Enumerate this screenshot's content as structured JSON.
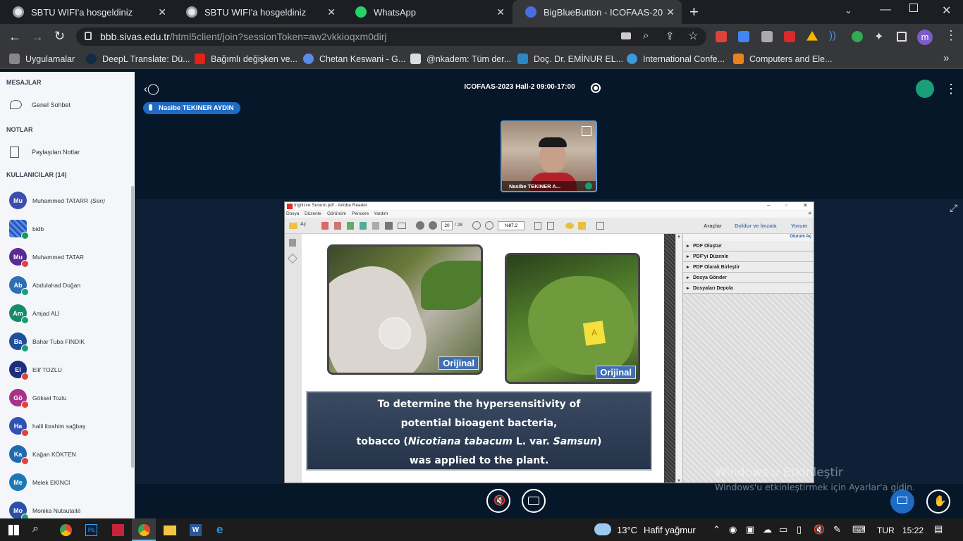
{
  "tabs": [
    {
      "title": "SBTU WIFI'a hosgeldiniz",
      "icon": "globe-icon"
    },
    {
      "title": "SBTU WIFI'a hosgeldiniz",
      "icon": "globe-icon"
    },
    {
      "title": "WhatsApp",
      "icon": "whatsapp-icon"
    },
    {
      "title": "BigBlueButton - ICOFAAS-2023 H",
      "icon": "bigbluebutton-icon"
    }
  ],
  "url": {
    "host": "bbb.sivas.edu.tr",
    "path": "/html5client/join?sessionToken=aw2vkkioqxm0dirj"
  },
  "bookmarks": [
    "Uygulamalar",
    "DeepL Translate: Dü...",
    "Bağımlı değişken ve...",
    "Chetan Keswani - G...",
    "@nkadem: Tüm der...",
    "Doç. Dr. EMİNUR EL...",
    "International Confe...",
    "Computers and Ele..."
  ],
  "profile_initial": "m",
  "sidebar": {
    "messages_header": "MESAJLAR",
    "public_chat": "Genel Sohbet",
    "notes_header": "NOTLAR",
    "shared_notes": "Paylaşılan Notlar",
    "users_header": "KULLANICILAR (14)",
    "users": [
      {
        "initials": "Mu",
        "name": "Muhammed TATARR",
        "suffix": "(Sen)",
        "color": "#3b4eab",
        "badge": ""
      },
      {
        "initials": "",
        "name": "bidb",
        "suffix": "",
        "color": "#2a57b8",
        "badge": "#0f9d58"
      },
      {
        "initials": "Mu",
        "name": "Muhammed TATAR",
        "suffix": "",
        "color": "#5b2a96",
        "badge": "#e0413b"
      },
      {
        "initials": "Ab",
        "name": "Abdulahad Doğan",
        "suffix": "",
        "color": "#2d6fb5",
        "badge": "#1a9e78"
      },
      {
        "initials": "Am",
        "name": "Amjad ALİ",
        "suffix": "",
        "color": "#168a6a",
        "badge": "#1a9e78"
      },
      {
        "initials": "Ba",
        "name": "Bahar Tuba FINDIK",
        "suffix": "",
        "color": "#1e4f9c",
        "badge": "#1a9e78"
      },
      {
        "initials": "El",
        "name": "Elif TOZLU",
        "suffix": "",
        "color": "#1b2f7a",
        "badge": "#e0413b"
      },
      {
        "initials": "Gö",
        "name": "Göksel Tozlu",
        "suffix": "",
        "color": "#a8328a",
        "badge": "#e0413b"
      },
      {
        "initials": "Ha",
        "name": "halil ibrahim sağbaş",
        "suffix": "",
        "color": "#3052b5",
        "badge": "#e0413b"
      },
      {
        "initials": "Ka",
        "name": "Kağan KÖKTEN",
        "suffix": "",
        "color": "#1f6ab0",
        "badge": "#e0413b"
      },
      {
        "initials": "Me",
        "name": "Melek EKİNCİ",
        "suffix": "",
        "color": "#1d78b8",
        "badge": ""
      },
      {
        "initials": "Mo",
        "name": "Monika Nutautaitė",
        "suffix": "",
        "color": "#2b4fa8",
        "badge": "#1a9e78"
      }
    ]
  },
  "meeting": {
    "title": "ICOFAAS-2023 Hall-2 09:00-17:00",
    "presenter": "Nasibe TEKINER AYDIN",
    "video_label": "Nasibe TEKINER A..."
  },
  "reader": {
    "title": "Ingilizce Sunum.pdf - Adobe Reader",
    "menu": [
      "Dosya",
      "Düzenle",
      "Görünüm",
      "Pencere",
      "Yardım"
    ],
    "open_label": "Aç",
    "page_current": "20",
    "page_total": "/ 28",
    "zoom": "%87,2",
    "panel_tabs": [
      "Araçlar",
      "Doldur ve İmzala",
      "Yorum"
    ],
    "signin": "Oturum Aç",
    "tools": [
      "PDF Oluştur",
      "PDF'yi Düzenle",
      "PDF Olarak Birleştir",
      "Dosya Gönder",
      "Dosyaları Depola"
    ],
    "badge_left": "Orijinal",
    "badge_right": "Orijinal",
    "leaf_label": "A",
    "caption_line1": "To determine the hypersensitivity of",
    "caption_line2": "potential bioagent bacteria,",
    "caption_line3_pre": "tobacco (",
    "caption_line3_italic": "Nicotiana tabacum",
    "caption_line3_mid": " L. var. ",
    "caption_line3_italic2": "Samsun",
    "caption_line3_post": ")",
    "caption_line4": "was applied to the plant."
  },
  "watermark": {
    "line1": "Windows'u Etkinleştir",
    "line2": "Windows'u etkinleştirmek için Ayarlar'a gidin."
  },
  "taskbar": {
    "temperature": "13°C",
    "weather": "Hafif yağmur",
    "language": "TUR",
    "time": "15:22"
  }
}
